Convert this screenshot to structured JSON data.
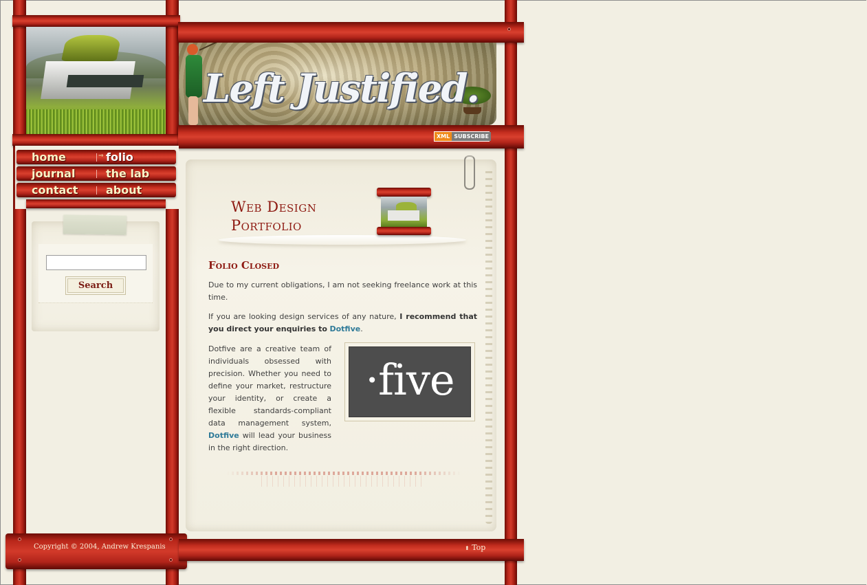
{
  "site": {
    "logo_text": "Left Justified.",
    "subscribe_badge": {
      "left": "XML",
      "right": "SUBSCRIBE"
    }
  },
  "nav": {
    "items": [
      {
        "label": "home",
        "active": false
      },
      {
        "label": "folio",
        "active": true
      },
      {
        "label": "journal",
        "active": false
      },
      {
        "label": "the lab",
        "active": false
      },
      {
        "label": "contact",
        "active": false
      },
      {
        "label": "about",
        "active": false
      }
    ],
    "active_arrow": "⇒"
  },
  "search": {
    "value": "",
    "placeholder": "",
    "button_label": "Search"
  },
  "page": {
    "title_line1": "Web Design",
    "title_line2": "Portfolio",
    "section_heading": "Folio Closed",
    "para1": "Due to my current obligations, I am not seeking freelance work at this time.",
    "para2_intro": "If you are looking design services of any nature,",
    "para2_bold": "I recommend that you direct your enquiries to",
    "para2_link": "Dotfive",
    "para2_end": ".",
    "para3_start": "Dotfive are a creative team of individuals obsessed with precision. Whether you need to define your market, restructure your identity, or create a flexible standards-compliant data management system,",
    "para3_link": "Dotfive",
    "para3_end": "will lead your business in the right direction.",
    "dotfive_logo_text": "·five"
  },
  "footer": {
    "copyright": "Copyright © 2004, Andrew Krespanis",
    "top_link": "Top",
    "top_arrow": "⬆"
  },
  "colors": {
    "wood": "#c22c1e",
    "background": "#f2efe3",
    "heading": "#8e1a12",
    "link": "#2f7a98",
    "nav_text": "#fbf3c6"
  }
}
